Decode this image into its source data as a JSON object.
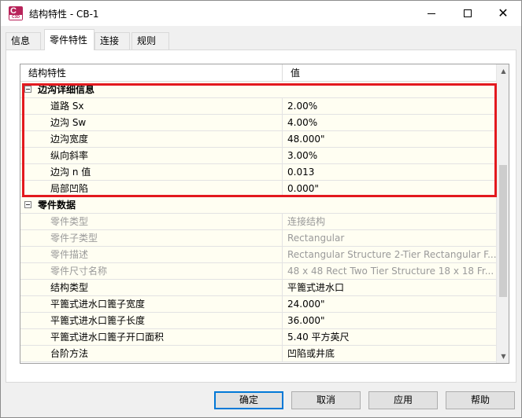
{
  "window": {
    "title": "结构特性 - CB-1",
    "icon_name": "civil3d-app-icon",
    "icon_text": "C",
    "icon_subtext": "C3D"
  },
  "tabs": [
    {
      "label": "信息",
      "active": false
    },
    {
      "label": "零件特性",
      "active": true
    },
    {
      "label": "连接",
      "active": false
    },
    {
      "label": "规则",
      "active": false
    }
  ],
  "grid": {
    "columns": {
      "name": "结构特性",
      "value": "值"
    },
    "group1": {
      "label": "边沟详细信息",
      "rows": [
        {
          "name": "道路 Sx",
          "value": "2.00%"
        },
        {
          "name": "边沟 Sw",
          "value": "4.00%"
        },
        {
          "name": "边沟宽度",
          "value": "48.000\""
        },
        {
          "name": "纵向斜率",
          "value": "3.00%"
        },
        {
          "name": "边沟 n 值",
          "value": "0.013"
        },
        {
          "name": "局部凹陷",
          "value": "0.000\""
        }
      ]
    },
    "group2": {
      "label": "零件数据",
      "rows": [
        {
          "name": "零件类型",
          "value": "连接结构",
          "disabled": true
        },
        {
          "name": "零件子类型",
          "value": "Rectangular",
          "disabled": true
        },
        {
          "name": "零件描述",
          "value": "Rectangular Structure 2-Tier Rectangular F...",
          "disabled": true
        },
        {
          "name": "零件尺寸名称",
          "value": "48 x 48 Rect Two Tier Structure 18 x 18 Fr...",
          "disabled": true
        },
        {
          "name": "结构类型",
          "value": "平篦式进水口",
          "disabled": false
        },
        {
          "name": "平篦式进水口篦子宽度",
          "value": "24.000\"",
          "disabled": false
        },
        {
          "name": "平篦式进水口篦子长度",
          "value": "36.000\"",
          "disabled": false
        },
        {
          "name": "平篦式进水口篦子开口面积",
          "value": "5.40 平方英尺",
          "disabled": false
        },
        {
          "name": "台阶方法",
          "value": "凹陷或井底",
          "disabled": false
        }
      ]
    }
  },
  "highlight_color": "#e3191f",
  "buttons": {
    "ok": "确定",
    "cancel": "取消",
    "apply": "应用",
    "help": "帮助"
  }
}
